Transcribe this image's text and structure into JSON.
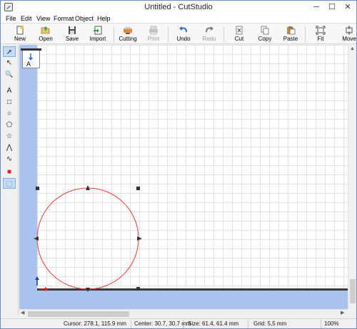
{
  "window": {
    "title": "Untitled - CutStudio",
    "minimize_glyph": "─",
    "maximize_glyph": "☐",
    "close_glyph": "✕"
  },
  "menu": [
    "File",
    "Edit",
    "View",
    "Format",
    "Object",
    "Help"
  ],
  "toolbar": [
    {
      "label": "New",
      "icon": "new-document-icon",
      "enabled": true
    },
    {
      "label": "Open",
      "icon": "open-folder-icon",
      "enabled": true
    },
    {
      "label": "Save",
      "icon": "save-icon",
      "enabled": true
    },
    {
      "label": "Import",
      "icon": "import-icon",
      "enabled": true
    },
    {
      "label": "Cutting",
      "icon": "cutting-icon",
      "enabled": true
    },
    {
      "label": "Print",
      "icon": "print-icon",
      "enabled": false
    },
    {
      "label": "Undo",
      "icon": "undo-icon",
      "enabled": true
    },
    {
      "label": "Redo",
      "icon": "redo-icon",
      "enabled": false
    },
    {
      "label": "Cut",
      "icon": "cut-icon",
      "enabled": true
    },
    {
      "label": "Copy",
      "icon": "copy-icon",
      "enabled": true
    },
    {
      "label": "Paste",
      "icon": "paste-icon",
      "enabled": true
    },
    {
      "label": "Fit",
      "icon": "fit-icon",
      "enabled": true
    },
    {
      "label": "Move",
      "icon": "move-icon",
      "enabled": true
    }
  ],
  "tools": [
    {
      "name": "select-tool-icon",
      "glyph": "➚",
      "active": true
    },
    {
      "name": "node-edit-tool-icon",
      "glyph": "↖",
      "active": false
    },
    {
      "name": "zoom-tool-icon",
      "glyph": "🔍",
      "active": false
    },
    {
      "name": "text-tool-icon",
      "glyph": "A",
      "active": false
    },
    {
      "name": "rectangle-tool-icon",
      "glyph": "□",
      "active": false
    },
    {
      "name": "ellipse-tool-icon",
      "glyph": "○",
      "active": false
    },
    {
      "name": "polygon-tool-icon",
      "glyph": "⬠",
      "active": false
    },
    {
      "name": "star-tool-icon",
      "glyph": "☆",
      "active": false
    },
    {
      "name": "polyline-tool-icon",
      "glyph": "⋀",
      "active": false
    },
    {
      "name": "curve-tool-icon",
      "glyph": "∿",
      "active": false
    },
    {
      "name": "fill-color-tool-icon",
      "glyph": "■",
      "active": false
    },
    {
      "name": "registration-mark-tool-icon",
      "glyph": "⬚",
      "active": true
    }
  ],
  "canvas": {
    "page_mark_text": "A",
    "shape_stroke_color": "#e8383a",
    "blue_area_color": "#a9c3ee"
  },
  "status": {
    "cursor": "Cursor: 278.1, 115.9 mm",
    "center": "Center: 30.7, 30.7 mm",
    "size": "Size: 61.4, 61.4 mm",
    "grid": "Grid: 5,5 mm",
    "zoom": "100%"
  },
  "colors": {
    "accent": "#2f6fbf",
    "title_text": "#1e1e1e"
  }
}
